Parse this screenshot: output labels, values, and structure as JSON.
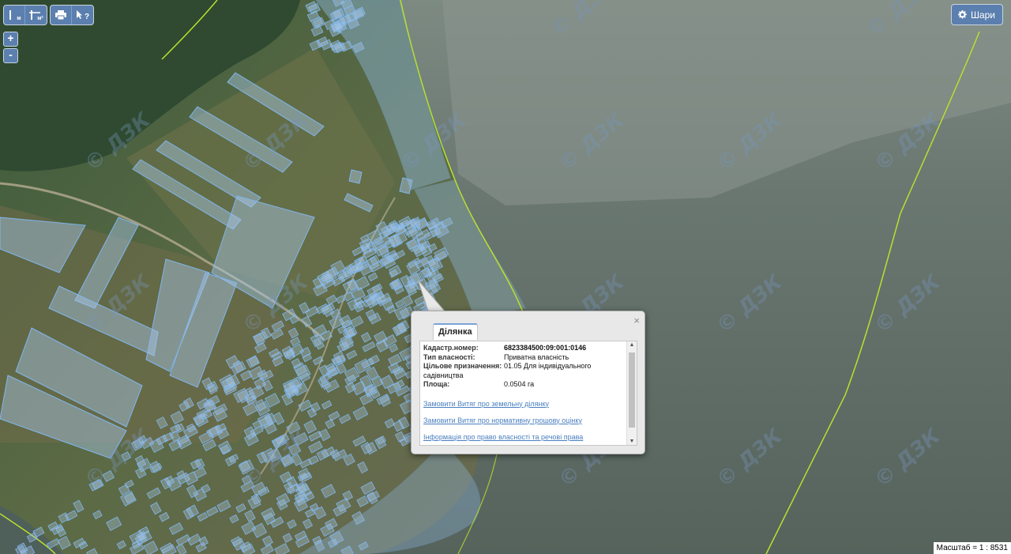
{
  "toolbar": {
    "measure_length_label": "м",
    "measure_area_label": "м²",
    "print_icon": "print-icon",
    "info_tool_label": "?"
  },
  "zoom": {
    "in_label": "+",
    "out_label": "-"
  },
  "layers_button": {
    "label": "Шари",
    "icon": "gear-icon"
  },
  "watermark": {
    "text": "© ДЗК"
  },
  "popup": {
    "tab_label": "Ділянка",
    "close_label": "×",
    "fields": [
      {
        "label": "Кадастр.номер:",
        "value": "6823384500:09:001:0146"
      },
      {
        "label": "Тип власності:",
        "value": "Приватна власність"
      },
      {
        "label": "Цільове призначення:",
        "value": "01.05 Для індивідуального садівництва"
      },
      {
        "label": "Площа:",
        "value": "0.0504 га"
      }
    ],
    "links": [
      "Замовити Витяг про земельну ділянку",
      "Замовити Витяг про нормативну грошову оцінку",
      "Інформація про право власності та речові права"
    ]
  },
  "scale": {
    "text": "Масштаб = 1 : 8531"
  },
  "colors": {
    "parcel_fill": "#a9c8e8",
    "parcel_stroke": "#7fb6ee",
    "boundary_line": "#b8e02e",
    "water": "#5e6a63",
    "ui_blue": "#5b7fae"
  }
}
